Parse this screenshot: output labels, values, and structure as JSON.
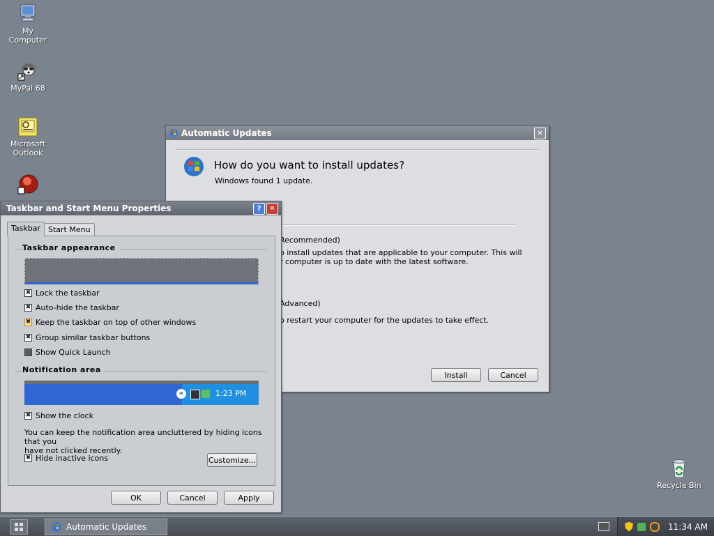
{
  "desktop": {
    "icons": [
      {
        "label_line1": "My",
        "label_line2": "Computer",
        "icon": "computer-icon"
      },
      {
        "label_line1": "MyPal 68",
        "label_line2": "",
        "icon": "raccoon-icon"
      },
      {
        "label_line1": "Microsoft",
        "label_line2": "Outlook",
        "icon": "outlook-icon"
      },
      {
        "label_line1": "",
        "label_line2": "",
        "icon": "red-orb-icon"
      },
      {
        "label_line1": "Recycle Bin",
        "label_line2": "",
        "icon": "recycle-bin-icon"
      }
    ]
  },
  "auto_updates": {
    "title": "Automatic Updates",
    "heading": "How do you want to install updates?",
    "subheading": "Windows found 1 update.",
    "option1_title": "Recommended)",
    "option1_desc_line1": "o install updates that are applicable to your computer. This will",
    "option1_desc_line2": "r computer is up to date with the latest software.",
    "option2_title": "Advanced)",
    "option2_desc": "o restart your computer for the updates to take effect.",
    "install_label": "Install",
    "cancel_label": "Cancel"
  },
  "taskbar_props": {
    "title": "Taskbar and Start Menu Properties",
    "tabs": [
      "Taskbar",
      "Start Menu"
    ],
    "appearance_title": "Taskbar appearance",
    "appearance_options": [
      {
        "label": "Lock the taskbar",
        "checked": true
      },
      {
        "label": "Auto-hide the taskbar",
        "checked": true
      },
      {
        "label": "Keep the taskbar on top of other windows",
        "checked": true
      },
      {
        "label": "Group similar taskbar buttons",
        "checked": true
      },
      {
        "label": "Show Quick Launch",
        "checked": false
      }
    ],
    "notification_title": "Notification area",
    "preview_time": "1:23 PM",
    "show_clock_label": "Show the clock",
    "info_line1": "You can keep the notification area uncluttered by hiding icons that you",
    "info_line2": "have not clicked recently.",
    "hide_inactive_label": "Hide inactive icons",
    "customize_label": "Customize...",
    "ok_label": "OK",
    "cancel_label": "Cancel",
    "apply_label": "Apply"
  },
  "taskbar": {
    "task_label": "Automatic Updates",
    "clock": "11:34 AM"
  },
  "colors": {
    "desktop": "#7b838f",
    "preview_blue": "#2f66d4"
  }
}
